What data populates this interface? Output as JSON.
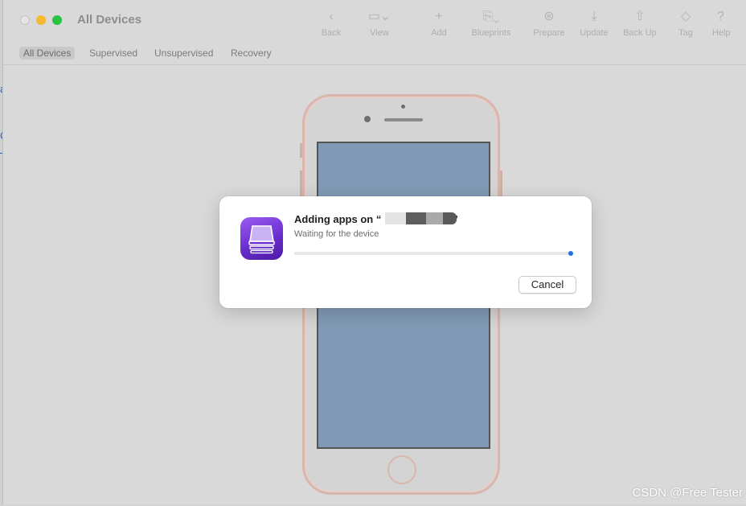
{
  "window": {
    "title": "All Devices"
  },
  "toolbar": [
    {
      "label": "Back",
      "icon": "chevron-left-icon",
      "glyph": "‹"
    },
    {
      "label": "View",
      "icon": "view-icon",
      "glyph": "▭⌄"
    },
    {
      "label": "Add",
      "icon": "plus-icon",
      "glyph": "+"
    },
    {
      "label": "Blueprints",
      "icon": "blueprints-icon",
      "glyph": "⎘⌄"
    },
    {
      "label": "Prepare",
      "icon": "prepare-icon",
      "glyph": "⊛"
    },
    {
      "label": "Update",
      "icon": "update-icon",
      "glyph": "⤓"
    },
    {
      "label": "Back Up",
      "icon": "backup-icon",
      "glyph": "⇧"
    },
    {
      "label": "Tag",
      "icon": "tag-icon",
      "glyph": "◇"
    },
    {
      "label": "Help",
      "icon": "help-icon",
      "glyph": "?"
    }
  ],
  "scope_tabs": [
    {
      "label": "All Devices",
      "active": true
    },
    {
      "label": "Supervised",
      "active": false
    },
    {
      "label": "Unsupervised",
      "active": false
    },
    {
      "label": "Recovery",
      "active": false
    }
  ],
  "dialog": {
    "title_prefix": "Adding apps on “",
    "title_suffix": "”",
    "subtitle": "Waiting for the device",
    "progress": 0.02,
    "cancel_label": "Cancel"
  },
  "watermark": "CSDN @Free Tester",
  "colors": {
    "accent": "#2270e0",
    "app_icon": "#6a2fcf",
    "close": "#e4e4e4",
    "minimize": "#f4b92e",
    "maximize": "#29c241"
  }
}
